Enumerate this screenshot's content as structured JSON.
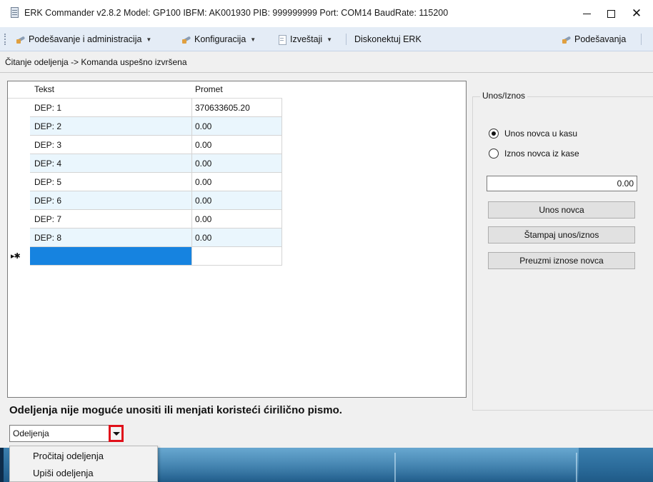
{
  "window": {
    "title": "ERK Commander v2.8.2 Model: GP100 IBFM: AK001930 PIB: 999999999 Port: COM14 BaudRate: 115200",
    "icon": "app-document-icon",
    "controls": {
      "minimize": "minimize-icon",
      "maximize": "maximize-icon",
      "close": "close-icon"
    }
  },
  "menu": {
    "items": [
      {
        "label": "Podešavanje i administracija",
        "icon": "tools-icon",
        "has_dropdown": true
      },
      {
        "label": "Konfiguracija",
        "icon": "tools-icon",
        "has_dropdown": true
      },
      {
        "label": "Izveštaji",
        "icon": "document-icon",
        "has_dropdown": true
      },
      {
        "label": "Diskonektuj ERK",
        "icon": "",
        "has_dropdown": false
      }
    ],
    "settings": {
      "label": "Podešavanja",
      "icon": "tools-icon"
    }
  },
  "status": {
    "text": "Čitanje odeljenja -> Komanda uspešno izvršena"
  },
  "grid": {
    "columns": [
      "Tekst",
      "Promet"
    ],
    "rows": [
      {
        "tekst": "DEP: 1",
        "promet": "370633605.20"
      },
      {
        "tekst": "DEP: 2",
        "promet": "0.00"
      },
      {
        "tekst": "DEP: 3",
        "promet": "0.00"
      },
      {
        "tekst": "DEP: 4",
        "promet": "0.00"
      },
      {
        "tekst": "DEP: 5",
        "promet": "0.00"
      },
      {
        "tekst": "DEP: 6",
        "promet": "0.00"
      },
      {
        "tekst": "DEP: 7",
        "promet": "0.00"
      },
      {
        "tekst": "DEP: 8",
        "promet": "0.00"
      }
    ],
    "new_row_marker": "▸✱"
  },
  "unos_iznos": {
    "legend": "Unos/Iznos",
    "radio_options": [
      {
        "label": "Unos novca u kasu",
        "checked": true
      },
      {
        "label": "Iznos novca iz kase",
        "checked": false
      }
    ],
    "amount": "0.00",
    "buttons": {
      "unos": "Unos novca",
      "stampaj": "Štampaj unos/iznos",
      "preuzmi": "Preuzmi iznose novca"
    }
  },
  "warning": {
    "text": "Odeljenja nije moguće unositi ili menjati koristeći ćirilično pismo."
  },
  "dropdown": {
    "selected": "Odeljenja",
    "options": [
      "Pročitaj odeljenja",
      "Upiši odeljenja"
    ],
    "highlight_color": "#e0101a"
  },
  "colors": {
    "menubar_bg": "#e4ecf6",
    "grid_alt_row": "#eaf6fd",
    "selected_cell": "#1683e0",
    "taskbar": "#2a6a99"
  }
}
